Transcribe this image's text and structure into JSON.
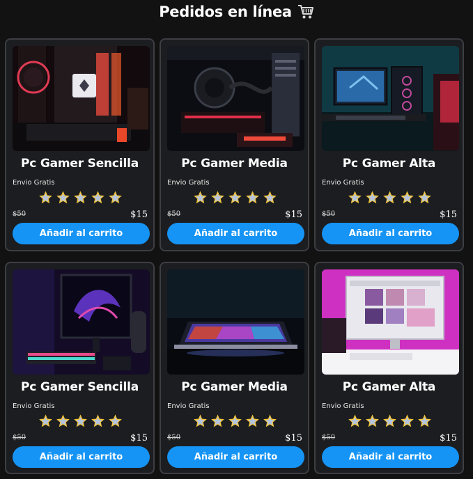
{
  "header": {
    "title": "Pedidos en línea",
    "icon": "shopping-cart-icon"
  },
  "colors": {
    "background": "#121213",
    "card_background": "#1c1d20",
    "card_border": "#3d3e42",
    "button": "#1594f6",
    "star_fill": "#f3c437",
    "star_inner": "#b5c4dd"
  },
  "products": [
    {
      "title": "Pc Gamer Sencilla",
      "shipping": "Envio Gratis",
      "rating": 5,
      "old_price": "$50",
      "price": "$15",
      "button_label": "Añadir al carrito",
      "image": "gaming-pc-interior-red-lights"
    },
    {
      "title": "Pc Gamer Media",
      "shipping": "Envio Gratis",
      "rating": 5,
      "old_price": "$50",
      "price": "$15",
      "button_label": "Añadir al carrito",
      "image": "pc-case-liquid-cooler-red"
    },
    {
      "title": "Pc Gamer Alta",
      "shipping": "Envio Gratis",
      "rating": 5,
      "old_price": "$50",
      "price": "$15",
      "button_label": "Añadir al carrito",
      "image": "desk-setup-teal-room"
    },
    {
      "title": "Pc Gamer Sencilla",
      "shipping": "Envio Gratis",
      "rating": 5,
      "old_price": "$50",
      "price": "$15",
      "button_label": "Añadir al carrito",
      "image": "rog-monitor-purple-setup"
    },
    {
      "title": "Pc Gamer Media",
      "shipping": "Envio Gratis",
      "rating": 5,
      "old_price": "$50",
      "price": "$15",
      "button_label": "Añadir al carrito",
      "image": "laptop-rainbow-glow"
    },
    {
      "title": "Pc Gamer Alta",
      "shipping": "Envio Gratis",
      "rating": 5,
      "old_price": "$50",
      "price": "$15",
      "button_label": "Añadir al carrito",
      "image": "imac-pink-neon-desk"
    }
  ]
}
